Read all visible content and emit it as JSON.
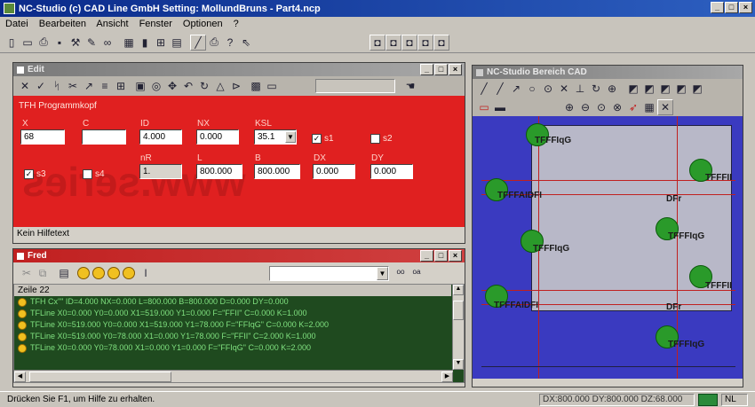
{
  "app": {
    "title": "NC-Studio (c) CAD Line GmbH Setting: MollundBruns - Part4.ncp"
  },
  "menu": [
    "Datei",
    "Bearbeiten",
    "Ansicht",
    "Fenster",
    "Optionen",
    "?"
  ],
  "edit_window": {
    "title": "Edit",
    "program_label": "TFH Programmkopf",
    "fields": {
      "x": {
        "label": "X",
        "value": "68"
      },
      "c": {
        "label": "C",
        "value": ""
      },
      "id": {
        "label": "ID",
        "value": "4.000"
      },
      "nx": {
        "label": "NX",
        "value": "0.000"
      },
      "ksl": {
        "label": "KSL",
        "value": "35.1"
      },
      "nr": {
        "label": "nR",
        "value": "1."
      },
      "l": {
        "label": "L",
        "value": "800.000"
      },
      "b": {
        "label": "B",
        "value": "800.000"
      },
      "dx": {
        "label": "DX",
        "value": "0.000"
      },
      "dy": {
        "label": "DY",
        "value": "0.000"
      }
    },
    "checkboxes": {
      "s1": {
        "label": "s1",
        "checked": true
      },
      "s2": {
        "label": "s2",
        "checked": false
      },
      "s3": {
        "label": "s3",
        "checked": true
      },
      "s4": {
        "label": "s4",
        "checked": false
      }
    },
    "help_text": "Kein Hilfetext",
    "watermark": "www.series"
  },
  "fred_window": {
    "title": "Fred",
    "header_line": "Zeile 22",
    "log_lines": [
      "TFH Cx\"\" ID=4.000 NX=0.000 L=800.000 B=800.000 D=0.000 DY=0.000",
      "TFLine X0=0.000 Y0=0.000 X1=519.000 Y1=0.000 F=\"FFII\" C=0.000 K=1.000",
      "TFLine X0=519.000 Y0=0.000 X1=519.000 Y1=78.000 F=\"FFIqG\" C=0.000 K=2.000",
      "TFLine X0=519.000 Y0=78.000 X1=0.000 Y1=78.000 F=\"FFII\" C=2.000 K=1.000",
      "TFLine X0=0.000 Y0=78.000 X1=0.000 Y1=0.000 F=\"FFIqG\" C=0.000 K=2.000"
    ]
  },
  "cad_window": {
    "title": "NC-Studio Bereich CAD",
    "labels": [
      "TFFFIqG",
      "TFFFII",
      "TFFFAIDFI",
      "DFr",
      "TFFFIqG",
      "TFFFIqG",
      "TFFFII",
      "TFFFAIDFI",
      "DFr",
      "TFFFIqG"
    ]
  },
  "status": {
    "help": "Drücken Sie F1, um Hilfe zu erhalten.",
    "coords": "DX:800.000 DY:800.000 DZ:68.000",
    "mode": "NL"
  },
  "colors": {
    "edit_bg": "#e02020",
    "log_bg": "#1f4a1f",
    "cad_bg": "#3a3ac0",
    "cad_sheet": "#b8b8c8"
  }
}
